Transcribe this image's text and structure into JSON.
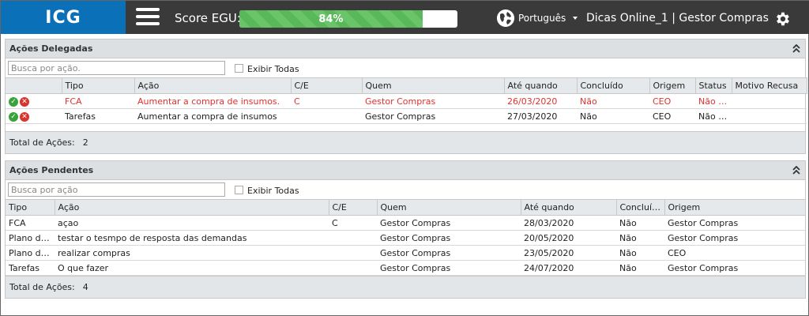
{
  "header": {
    "logo": "ICG",
    "score_label": "Score EGU:",
    "score_value": "84%",
    "score_fraction": 0.84,
    "language": "Português",
    "user_info": "Dicas Online_1  |  Gestor Compras"
  },
  "delegadas": {
    "title": "Ações Delegadas",
    "search_placeholder": "Busca por ação.",
    "show_all": "Exibir Todas",
    "columns": [
      "",
      "Tipo",
      "Ação",
      "C/E",
      "Quem",
      "Até quando",
      "Concluído",
      "Origem",
      "Status",
      "Motivo Recusa"
    ],
    "rows": [
      [
        "FCA",
        "Aumentar a compra de insumos.",
        "C",
        "Gestor Compras",
        "26/03/2020",
        "Não",
        "CEO",
        "Não D...",
        ""
      ],
      [
        "Tarefas",
        "Aumentar a compra de insumos",
        "",
        "Gestor Compras",
        "27/03/2020",
        "Não",
        "CEO",
        "Não D...",
        ""
      ]
    ],
    "total_label": "Total de Ações:",
    "total_value": "2"
  },
  "pendentes": {
    "title": "Ações Pendentes",
    "search_placeholder": "Busca por ação",
    "show_all": "Exibir Todas",
    "columns": [
      "Tipo",
      "Ação",
      "C/E",
      "Quem",
      "Até quando",
      "Concluído",
      "Origem"
    ],
    "rows": [
      [
        "FCA",
        "açao",
        "C",
        "Gestor Compras",
        "28/03/2020",
        "Não",
        "Gestor Compras"
      ],
      [
        "Plano de ...",
        "testar o tesmpo de resposta das demandas",
        "",
        "Gestor Compras",
        "20/05/2020",
        "Não",
        "Gestor Compras"
      ],
      [
        "Plano de ...",
        "realizar compras",
        "",
        "Gestor Compras",
        "23/05/2020",
        "Não",
        "CEO"
      ],
      [
        "Tarefas",
        "O que fazer",
        "",
        "Gestor Compras",
        "24/07/2020",
        "Não",
        "Gestor Compras"
      ]
    ],
    "total_label": "Total de Ações:",
    "total_value": "4"
  }
}
